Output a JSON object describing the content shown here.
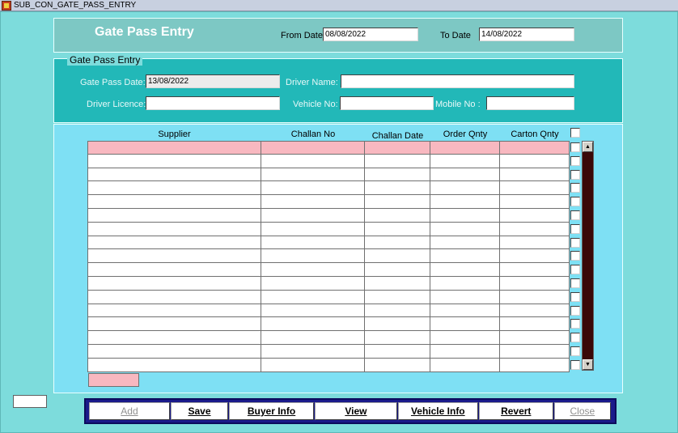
{
  "window": {
    "title": "SUB_CON_GATE_PASS_ENTRY"
  },
  "header": {
    "title": "Gate Pass Entry",
    "from_date_label": "From Date",
    "from_date_value": "08/08/2022",
    "to_date_label": "To Date",
    "to_date_value": "14/08/2022"
  },
  "entry": {
    "legend": "Gate Pass Entry",
    "gate_pass_date_label": "Gate Pass Date:",
    "gate_pass_date_value": "13/08/2022",
    "driver_name_label": "Driver Name:",
    "driver_name_value": "",
    "driver_licence_label": "Driver Licence:",
    "driver_licence_value": "",
    "vehicle_no_label": "Vehicle No:",
    "vehicle_no_value": "",
    "mobile_no_label": "Mobile No :",
    "mobile_no_value": ""
  },
  "grid": {
    "columns": [
      "Supplier",
      "Challan No",
      "Challan Date",
      "Order Qnty",
      "Carton Qnty"
    ],
    "row_count": 17
  },
  "buttons": {
    "add": "Add",
    "save": "Save",
    "buyer_info": "Buyer Info",
    "view": "View",
    "vehicle_info": "Vehicle Info",
    "revert": "Revert",
    "close": "Close"
  },
  "colors": {
    "form_bg": "#7ddcdc",
    "entry_panel": "#22b8b8",
    "grid_panel": "#7ee0f4",
    "selected_row": "#f8b8c0",
    "button_bar": "#1a1a8a"
  }
}
